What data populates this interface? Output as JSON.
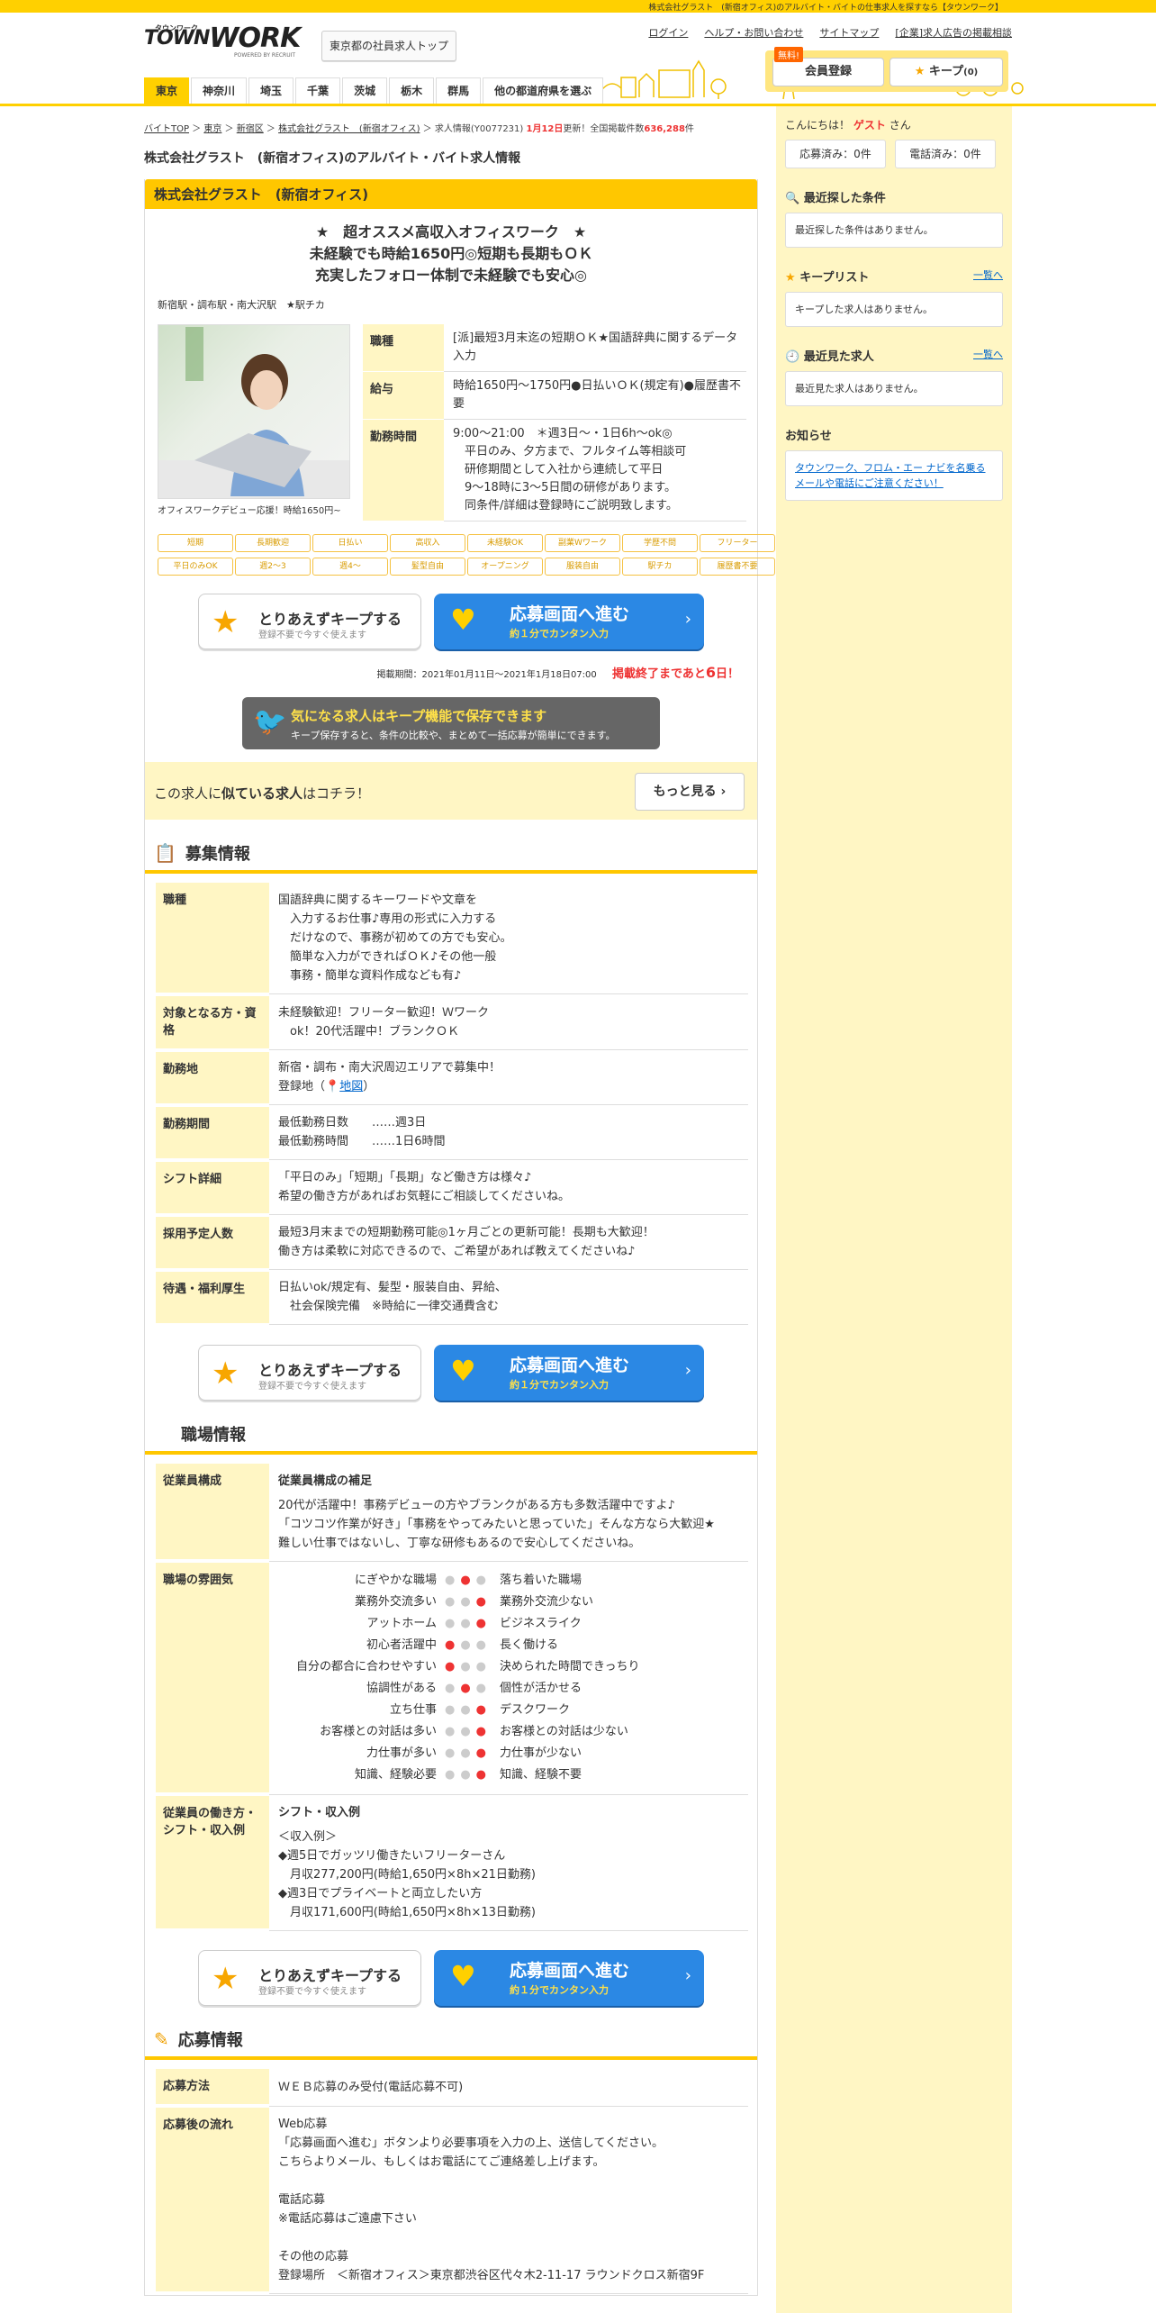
{
  "topstrip": "株式会社グラスト　(新宿オフィス)のアルバイト・バイトの仕事求人を探すなら【タウンワーク】",
  "logo": {
    "kana": "タウンワーク",
    "brand": "TOWN",
    "brand2": "WORK",
    "powered": "POWERED BY RECRUIT"
  },
  "header": {
    "top_button": "東京都の社員求人トップ",
    "links": [
      "ログイン",
      "ヘルプ・お問い合わせ",
      "サイトマップ",
      "[企業]求人広告の掲載相談"
    ],
    "free_badge": "無料!",
    "member_button": "会員登録",
    "keep_button": "キープ",
    "keep_count": "(0)"
  },
  "nav": {
    "items": [
      "東京",
      "神奈川",
      "埼玉",
      "千葉",
      "茨城",
      "栃木",
      "群馬",
      "他の都道府県を選ぶ"
    ],
    "active": 0
  },
  "breadcrumb": {
    "items": [
      "バイトTOP",
      "東京",
      "新宿区",
      "株式会社グラスト　(新宿オフィス)",
      "求人情報(Y0077231)"
    ],
    "updated": "1月12日",
    "update_text": "更新！全国掲載件数",
    "total": "636,288",
    "unit": "件"
  },
  "page_title": "株式会社グラスト　(新宿オフィス)のアルバイト・バイト求人情報",
  "company": "株式会社グラスト　(新宿オフィス)",
  "catch": [
    "★　超オススメ高収入オフィスワーク　★",
    "未経験でも時給1650円◎短期も長期もＯＫ",
    "充実したフォロー体制で未経験でも安心◎"
  ],
  "station": "新宿駅・調布駅・南大沢駅　★駅チカ",
  "photo_caption": "オフィスワークデビュー応援！時給1650円~",
  "summary": [
    {
      "label": "職種",
      "value": "[派]最短3月末迄の短期ＯＫ★国語辞典に関するデータ入力"
    },
    {
      "label": "給与",
      "value": "時給1650円～1750円●日払いＯＫ(規定有)●履歴書不要"
    },
    {
      "label": "勤務時間",
      "value": "9:00～21:00　＊週3日～・1日6h～ok◎\n　平日のみ、夕方まで、フルタイム等相談可\n　研修期間として入社から連続して平日\n　9～18時に3～5日間の研修があります。\n　同条件/詳細は登録時にご説明致します。"
    }
  ],
  "tags": [
    "短期",
    "長期歓迎",
    "日払い",
    "高収入",
    "未経験OK",
    "副業Wワーク",
    "学歴不問",
    "フリーター",
    "平日のみOK",
    "週2～3",
    "週4～",
    "髪型自由",
    "オープニング",
    "服装自由",
    "駅チカ",
    "履歴書不要"
  ],
  "cta": {
    "keep_title": "とりあえずキープする",
    "keep_sub": "登録不要で今すぐ使えます",
    "apply_title": "応募画面へ進む",
    "apply_sub": "約１分でカンタン入力"
  },
  "period": {
    "text": "掲載期間：2021年01月11日～2021年1月18日07:00",
    "remain_prefix": "掲載終了まであと",
    "remain_days": "6",
    "remain_suffix": "日！"
  },
  "keep_banner": {
    "title": "気になる求人はキープ機能で保存できます",
    "sub": "キープ保存すると、条件の比較や、まとめて一括応募が簡単にできます。"
  },
  "similar": {
    "pre": "この求人に",
    "bold": "似ている求人",
    "post": "はコチラ！",
    "button": "もっと見る"
  },
  "sections": {
    "recruit": "募集情報",
    "workplace": "職場情報",
    "apply": "応募情報"
  },
  "recruit": [
    {
      "label": "職種",
      "value": "国語辞典に関するキーワードや文章を\n　入力するお仕事♪専用の形式に入力する\n　だけなので、事務が初めての方でも安心。\n　簡単な入力ができればＯＫ♪その他一般\n　事務・簡単な資料作成なども有♪"
    },
    {
      "label": "対象となる方・資格",
      "value": "未経験歓迎！フリーター歓迎！Ｗワーク\n　ok！20代活躍中！ブランクＯＫ"
    },
    {
      "label": "勤務地",
      "value": "新宿・調布・南大沢周辺エリアで募集中！",
      "extra": "登録地",
      "map": "地図"
    },
    {
      "label": "勤務期間",
      "value": "最低勤務日数　　……週3日\n最低勤務時間　　……1日6時間"
    },
    {
      "label": "シフト詳細",
      "value": "「平日のみ」「短期」「長期」など働き方は様々♪\n希望の働き方があればお気軽にご相談してくださいね。"
    },
    {
      "label": "採用予定人数",
      "value": "最短3月末までの短期勤務可能◎1ヶ月ごとの更新可能！長期も大歓迎！\n働き方は柔軟に対応できるので、ご希望があれば教えてくださいね♪"
    },
    {
      "label": "待遇・福利厚生",
      "value": "日払いok/規定有、髪型・服装自由、昇給、\n　社会保険完備　※時給に一律交通費含む"
    }
  ],
  "workplace": {
    "staff_label": "従業員構成",
    "staff_title": "従業員構成の補足",
    "staff_text": "20代が活躍中！事務デビューの方やブランクがある方も多数活躍中ですよ♪\n「コツコツ作業が好き」「事務をやってみたいと思っていた」そんな方なら大歓迎★\n難しい仕事ではないし、丁寧な研修もあるので安心してくださいね。",
    "atmos_label": "職場の雰囲気",
    "atmos": [
      {
        "left": "にぎやかな職場",
        "right": "落ち着いた職場",
        "level": 2
      },
      {
        "left": "業務外交流多い",
        "right": "業務外交流少ない",
        "level": 3
      },
      {
        "left": "アットホーム",
        "right": "ビジネスライク",
        "level": 3
      },
      {
        "left": "初心者活躍中",
        "right": "長く働ける",
        "level": 1
      },
      {
        "left": "自分の都合に合わせやすい",
        "right": "決められた時間できっちり",
        "level": 1
      },
      {
        "left": "協調性がある",
        "right": "個性が活かせる",
        "level": 2
      },
      {
        "left": "立ち仕事",
        "right": "デスクワーク",
        "level": 3
      },
      {
        "left": "お客様との対話は多い",
        "right": "お客様との対話は少ない",
        "level": 3
      },
      {
        "left": "力仕事が多い",
        "right": "力仕事が少ない",
        "level": 3
      },
      {
        "left": "知識、経験必要",
        "right": "知識、経験不要",
        "level": 3
      }
    ],
    "shift_label": "従業員の働き方・シフト・収入例",
    "shift_title": "シフト・収入例",
    "shift_text": "＜収入例＞\n◆週5日でガッツリ働きたいフリーターさん\n　月収277,200円(時給1,650円×8h×21日勤務)\n◆週3日でプライベートと両立したい方\n　月収171,600円(時給1,650円×8h×13日勤務)"
  },
  "apply": [
    {
      "label": "応募方法",
      "value": "ＷＥＢ応募のみ受付(電話応募不可)"
    },
    {
      "label": "応募後の流れ",
      "value": "Web応募\n「応募画面へ進む」ボタンより必要事項を入力の上、送信してください。\nこちらよりメール、もしくはお電話にてご連絡差し上げます。\n\n電話応募\n※電話応募はご遠慮下さい\n\nその他の応募\n登録場所　＜新宿オフィス＞東京都渋谷区代々木2-11-17 ラウンドクロス新宿9F"
    }
  ],
  "sidebar": {
    "greet_pre": "こんにちは！",
    "guest": "ゲスト",
    "greet_post": "さん",
    "applied_web": "応募済み：0件",
    "applied_tel": "電話済み：0件",
    "recent_cond_title": "最近探した条件",
    "recent_cond_empty": "最近探した条件はありません。",
    "keep_title": "キープリスト",
    "keep_link": "一覧へ",
    "keep_empty": "キープした求人はありません。",
    "viewed_title": "最近見た求人",
    "viewed_link": "一覧へ",
    "viewed_empty": "最近見た求人はありません。",
    "notice_title": "お知らせ",
    "notice_text": "タウンワーク、フロム・エー ナビを名乗るメールや電話にご注意ください！"
  }
}
